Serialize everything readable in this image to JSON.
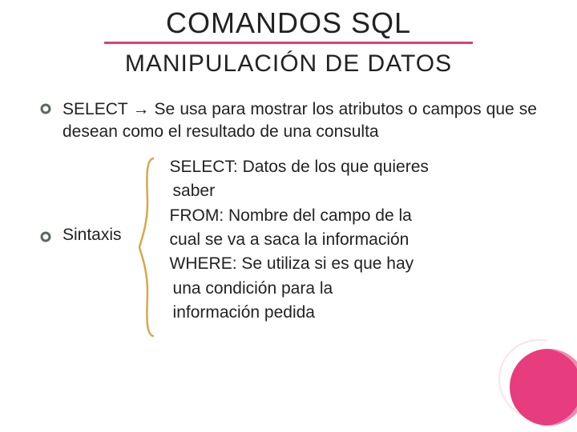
{
  "title": "COMANDOS SQL",
  "subtitle": "MANIPULACIÓN DE DATOS",
  "bullet1_keyword": "SELECT",
  "bullet1_arrow": "→",
  "bullet1_rest": " Se usa para mostrar los atributos o campos que se desean como el resultado de una consulta",
  "syntax_label": "Sintaxis",
  "syntax_lines": {
    "l1": "SELECT: Datos de los que quieres",
    "l2": "saber",
    "l3": "FROM: Nombre del campo de la",
    "l4": "cual se va a saca la información",
    "l5": "WHERE: Se utiliza si es que hay",
    "l6": "una condición  para la",
    "l7": "información pedida"
  },
  "accent_color": "#e73c7e"
}
